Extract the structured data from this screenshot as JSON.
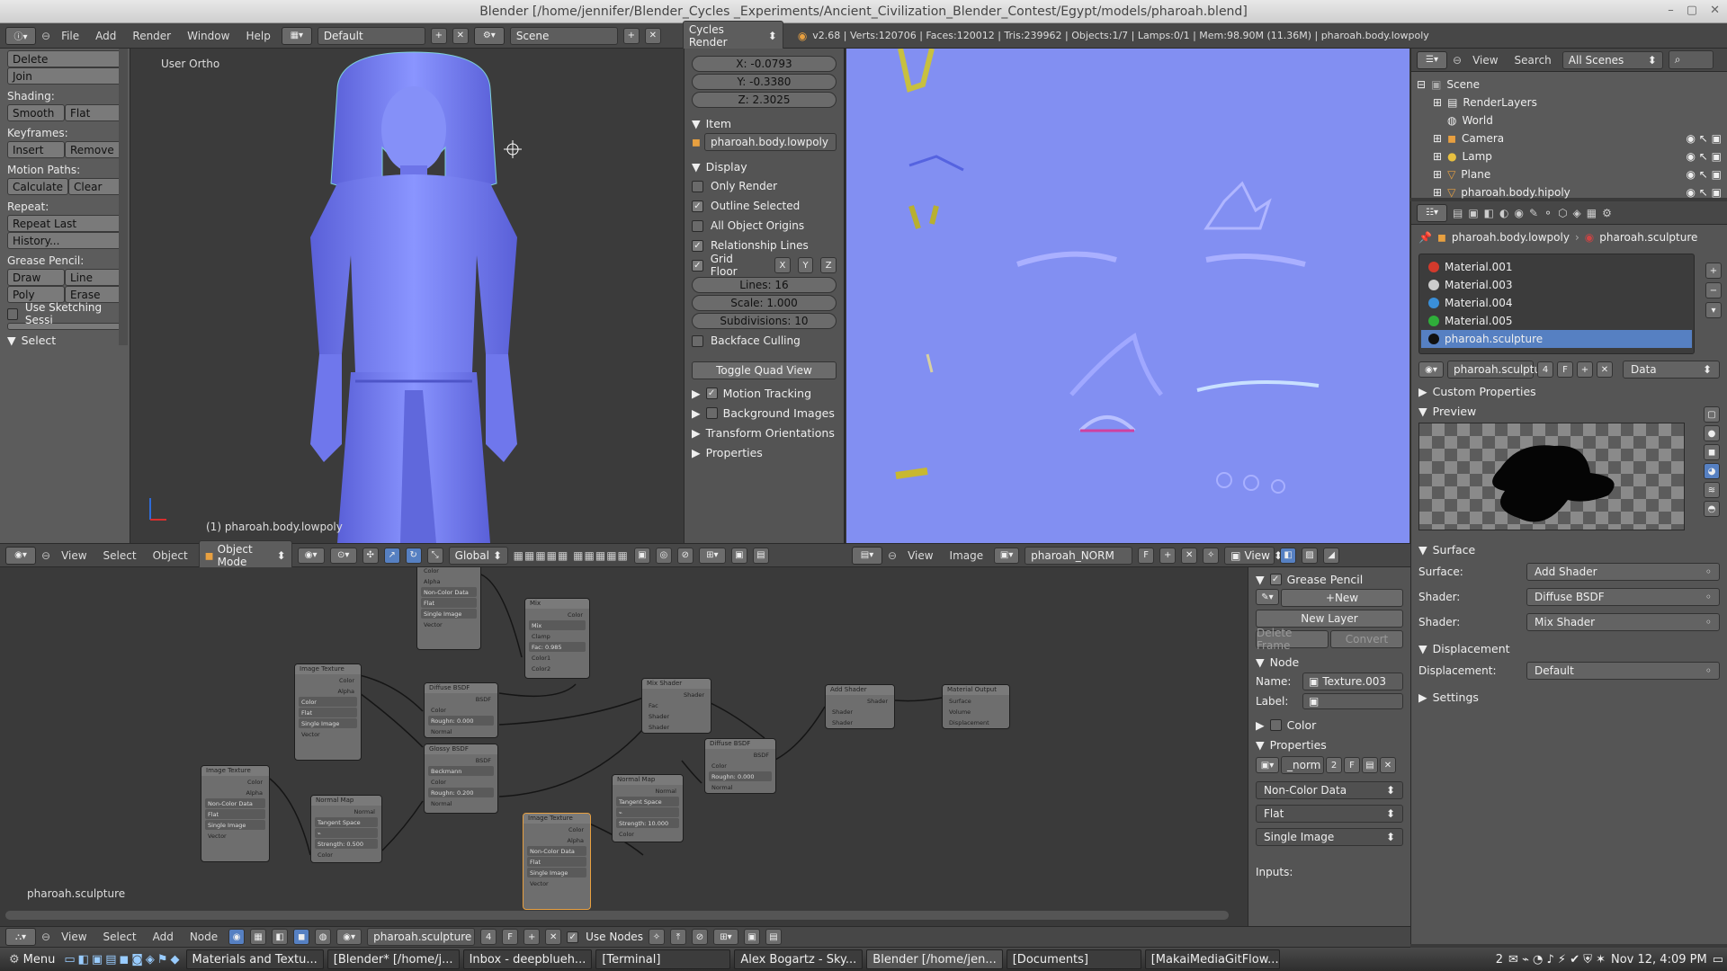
{
  "window": {
    "title": "Blender [/home/jennifer/Blender_Cycles _Experiments/Ancient_Civilization_Blender_Contest/Egypt/models/pharoah.blend]",
    "controls": [
      "–",
      "▢",
      "✕"
    ]
  },
  "infobar": {
    "menus": [
      "File",
      "Add",
      "Render",
      "Window",
      "Help"
    ],
    "layout": "Default",
    "scene": "Scene",
    "engine": "Cycles Render",
    "stats": "v2.68 | Verts:120706 | Faces:120012 | Tris:239962 | Objects:1/7 | Lamps:0/1 | Mem:98.90M (11.36M) | pharoah.body.lowpoly"
  },
  "toolshelf": {
    "delete": "Delete",
    "join": "Join",
    "shading_label": "Shading:",
    "smooth": "Smooth",
    "flat": "Flat",
    "keyframes_label": "Keyframes:",
    "insert": "Insert",
    "remove": "Remove",
    "motion_label": "Motion Paths:",
    "calculate": "Calculate",
    "clear": "Clear",
    "repeat_label": "Repeat:",
    "repeat_last": "Repeat Last",
    "history": "History...",
    "grease_label": "Grease Pencil:",
    "draw": "Draw",
    "line": "Line",
    "poly": "Poly",
    "erase": "Erase",
    "sketching": "Use Sketching Sessi",
    "select": "Select"
  },
  "viewport": {
    "view_label": "User Ortho",
    "object_label": "(1) pharoah.body.lowpoly"
  },
  "npanel": {
    "x": "X: -0.0793",
    "y": "Y: -0.3380",
    "z": "Z: 2.3025",
    "item": "Item",
    "item_name": "pharoah.body.lowpoly",
    "display": "Display",
    "only_render": "Only Render",
    "outline_selected": "Outline Selected",
    "all_origins": "All Object Origins",
    "relationship_lines": "Relationship Lines",
    "grid_floor": "Grid Floor",
    "lines": "Lines: 16",
    "scale": "Scale: 1.000",
    "subdivisions": "Subdivisions: 10",
    "backface": "Backface Culling",
    "toggle_quad": "Toggle Quad View",
    "motion_tracking": "Motion Tracking",
    "background_images": "Background Images",
    "transform_orientations": "Transform Orientations",
    "properties": "Properties",
    "axis": [
      "X",
      "Y",
      "Z"
    ]
  },
  "viewport_header": {
    "menus": [
      "View",
      "Select",
      "Object"
    ],
    "mode": "Object Mode",
    "orientation": "Global"
  },
  "uv_header": {
    "menus": [
      "View",
      "Image"
    ],
    "image": "pharoah_NORM",
    "fake": "F",
    "view": "View"
  },
  "outliner": {
    "menus": [
      "View",
      "Search"
    ],
    "scope": "All Scenes",
    "items": [
      "Scene",
      "RenderLayers",
      "World",
      "Camera",
      "Lamp",
      "Plane",
      "pharoah.body.hipoly"
    ]
  },
  "props": {
    "breadcrumb_obj": "pharoah.body.lowpoly",
    "breadcrumb_mat": "pharoah.sculpture",
    "materials": [
      "Material.001",
      "Material.003",
      "Material.004",
      "Material.005",
      "pharoah.sculpture"
    ],
    "material_colors": [
      "#d33a2c",
      "#cccccc",
      "#3a8fd8",
      "#2fae3a",
      "#111111"
    ],
    "mat_name": "pharoah.sculpture",
    "mat_users": "4",
    "mat_fake": "F",
    "data_mode": "Data",
    "custom_properties": "Custom Properties",
    "preview": "Preview",
    "surface_section": "Surface",
    "surface_label": "Surface:",
    "surface_value": "Add Shader",
    "shader1_label": "Shader:",
    "shader1_value": "Diffuse BSDF",
    "shader2_label": "Shader:",
    "shader2_value": "Mix Shader",
    "displacement_section": "Displacement",
    "displacement_label": "Displacement:",
    "displacement_value": "Default",
    "settings": "Settings"
  },
  "nodeside": {
    "grease_pencil": "Grease Pencil",
    "new": "New",
    "new_layer": "New Layer",
    "delete_frame": "Delete Frame",
    "convert": "Convert",
    "node": "Node",
    "name_label": "Name:",
    "name_value": "Texture.003",
    "label_label": "Label:",
    "color": "Color",
    "properties": "Properties",
    "image_name": "_norm",
    "image_users": "2",
    "image_fake": "F",
    "color_space": "Non-Color Data",
    "projection": "Flat",
    "source": "Single Image",
    "inputs": "Inputs:"
  },
  "node_editor": {
    "material_label": "pharoah.sculpture"
  },
  "node_header": {
    "menus": [
      "View",
      "Select",
      "Add",
      "Node"
    ],
    "material": "pharoah.sculpture",
    "users": "4",
    "fake": "F",
    "use_nodes": "Use Nodes"
  },
  "nodes": {
    "image_texture": "Image Texture",
    "mix": "Mix",
    "diffuse": "Diffuse BSDF",
    "glossy": "Glossy BSDF",
    "mix_shader": "Mix Shader",
    "add_shader": "Add Shader",
    "material_output": "Material Output",
    "normal_map": "Normal Map",
    "tangent": "Tangent Space",
    "beckmann": "Beckmann",
    "color": "Color",
    "alpha": "Alpha",
    "non_color": "Non-Color Data",
    "flat": "Flat",
    "single": "Single Image",
    "vector": "Vector",
    "fac": "Fac: 0.985",
    "roughness0": "Roughn: 0.000",
    "roughness2": "Roughn: 0.200",
    "strength05": "Strength: 0.500",
    "strength10": "Strength: 10.000",
    "shader": "Shader",
    "bsdf": "BSDF",
    "normal": "Normal",
    "surface": "Surface",
    "volume": "Volume",
    "displacement": "Displacement",
    "clamp": "Clamp",
    "color1": "Color1",
    "color2": "Color2",
    "fac_label": "Fac",
    "strength_label": "Strength"
  },
  "taskbar": {
    "menu": "Menu",
    "tasks": [
      "Materials and Textu...",
      "[Blender* [/home/j...",
      "Inbox - deepblueh...",
      "[Terminal]",
      "Alex Bogartz - Sky...",
      "Blender [/home/jen...",
      "[Documents]",
      "[MakaiMediaGitFlow..."
    ],
    "workspace": "2",
    "clock": "Nov 12,  4:09 PM"
  }
}
